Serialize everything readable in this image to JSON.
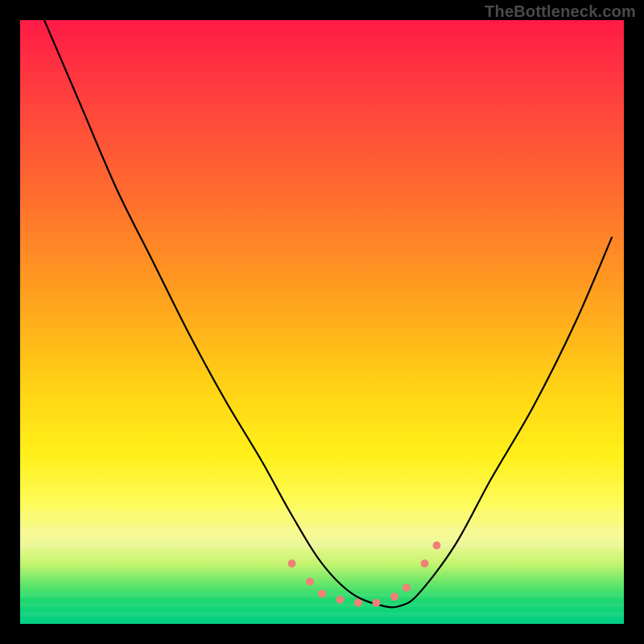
{
  "watermark": "TheBottleneck.com",
  "chart_data": {
    "type": "line",
    "title": "",
    "xlabel": "",
    "ylabel": "",
    "xlim": [
      0,
      100
    ],
    "ylim": [
      0,
      100
    ],
    "grid": false,
    "legend": false,
    "gradient_stops": [
      {
        "pos": 0.0,
        "color": "#ff1a46"
      },
      {
        "pos": 0.5,
        "color": "#ffc018"
      },
      {
        "pos": 0.8,
        "color": "#fff85a"
      },
      {
        "pos": 1.0,
        "color": "#00cf86"
      }
    ],
    "series": [
      {
        "name": "bottleneck-curve",
        "color": "#000000",
        "x": [
          4,
          10,
          16,
          22,
          28,
          34,
          40,
          45,
          50,
          55,
          60,
          63,
          66,
          72,
          78,
          85,
          92,
          98
        ],
        "y": [
          100,
          86,
          72,
          60,
          48,
          37,
          27,
          18,
          10,
          5,
          3,
          3,
          5,
          13,
          24,
          36,
          50,
          64
        ]
      }
    ],
    "markers": {
      "name": "highlight-points",
      "color": "#f08078",
      "radius": 5,
      "points": [
        {
          "x": 45,
          "y": 10
        },
        {
          "x": 48,
          "y": 7
        },
        {
          "x": 50,
          "y": 5
        },
        {
          "x": 53,
          "y": 4
        },
        {
          "x": 56,
          "y": 3.5
        },
        {
          "x": 59,
          "y": 3.5
        },
        {
          "x": 62,
          "y": 4.5
        },
        {
          "x": 64,
          "y": 6
        },
        {
          "x": 67,
          "y": 10
        },
        {
          "x": 69,
          "y": 13
        }
      ]
    }
  }
}
